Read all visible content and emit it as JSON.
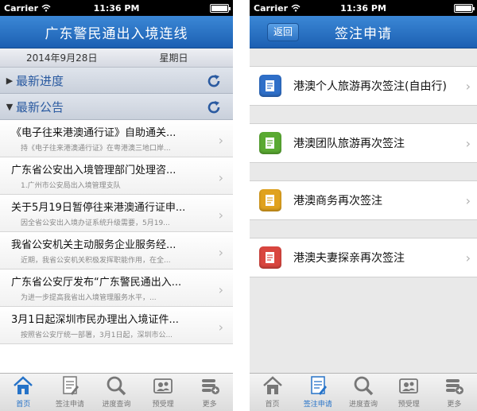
{
  "status": {
    "carrier": "Carrier",
    "time": "11:36 PM"
  },
  "left": {
    "title": "广东警民通出入境连线",
    "date": "2014年9月28日",
    "weekday": "星期日",
    "sections": [
      {
        "label": "最新进度"
      },
      {
        "label": "最新公告"
      }
    ],
    "news": [
      {
        "title": "《电子往来港澳通行证》自助通关...",
        "subtitle": "持《电子往来港澳通行证》在粤港澳三地口岸..."
      },
      {
        "title": "广东省公安出入境管理部门处理咨...",
        "subtitle": "1.广州市公安局出入境管理支队"
      },
      {
        "title": "关于5月19日暂停往来港澳通行证申...",
        "subtitle": "因全省公安出入境办证系统升级需要，5月19..."
      },
      {
        "title": "我省公安机关主动服务企业服务经...",
        "subtitle": "近期，我省公安机关积极发挥职能作用，在全..."
      },
      {
        "title": "广东省公安厅发布“广东警民通出入...",
        "subtitle": "为进一步提高我省出入境管理服务水平，..."
      },
      {
        "title": "3月1日起深圳市民办理出入境证件...",
        "subtitle": "按照省公安厅统一部署，3月1日起，深圳市公..."
      }
    ]
  },
  "right": {
    "back_label": "返回",
    "title": "签注申请",
    "items": [
      {
        "label": "港澳个人旅游再次签注(自由行)",
        "color": "#2f6fc8"
      },
      {
        "label": "港澳团队旅游再次签注",
        "color": "#5aaa32"
      },
      {
        "label": "港澳商务再次签注",
        "color": "#e0a21e"
      },
      {
        "label": "港澳夫妻探亲再次签注",
        "color": "#d9463f"
      }
    ]
  },
  "tabs": [
    {
      "label": "首页",
      "icon": "home-icon"
    },
    {
      "label": "签注申请",
      "icon": "visa-form-icon"
    },
    {
      "label": "进度查询",
      "icon": "search-icon"
    },
    {
      "label": "预受理",
      "icon": "id-card-icon"
    },
    {
      "label": "更多",
      "icon": "more-icon"
    }
  ],
  "colors": {
    "nav_blue": "#1c5fb2",
    "active_tab": "#2673c8"
  }
}
